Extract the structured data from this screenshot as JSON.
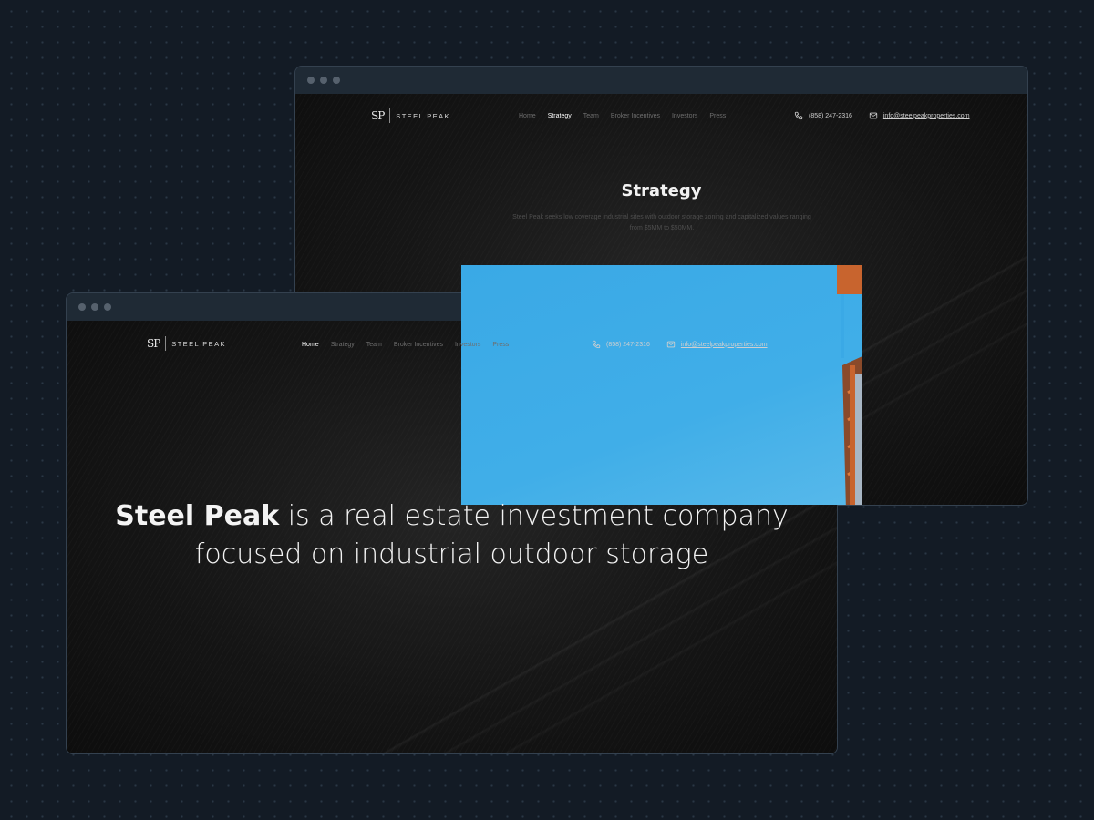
{
  "brand": {
    "monogram": "SP",
    "name": "STEEL PEAK"
  },
  "nav": {
    "items": [
      "Home",
      "Strategy",
      "Team",
      "Broker Incentives",
      "Investors",
      "Press"
    ]
  },
  "contact": {
    "phone": "(858) 247-2316",
    "email": "info@steelpeakproperties.com",
    "phone_icon": "phone-icon",
    "email_icon": "mail-icon"
  },
  "back_window": {
    "active_nav": "Strategy",
    "title": "Strategy",
    "text": "Steel Peak seeks low coverage industrial sites with outdoor storage zoning and capitalized values ranging from $5MM to $50MM."
  },
  "front_window": {
    "active_nav": "Home",
    "hero_brand": "Steel Peak",
    "hero_rest": " is a real estate investment company focused on industrial outdoor storage"
  },
  "colors": {
    "backdrop": "#131b25",
    "window_chrome": "#1f2a35",
    "page_bg": "#151515",
    "photo_sky": "#3aa9e6",
    "crane_orange": "#c8642e"
  }
}
